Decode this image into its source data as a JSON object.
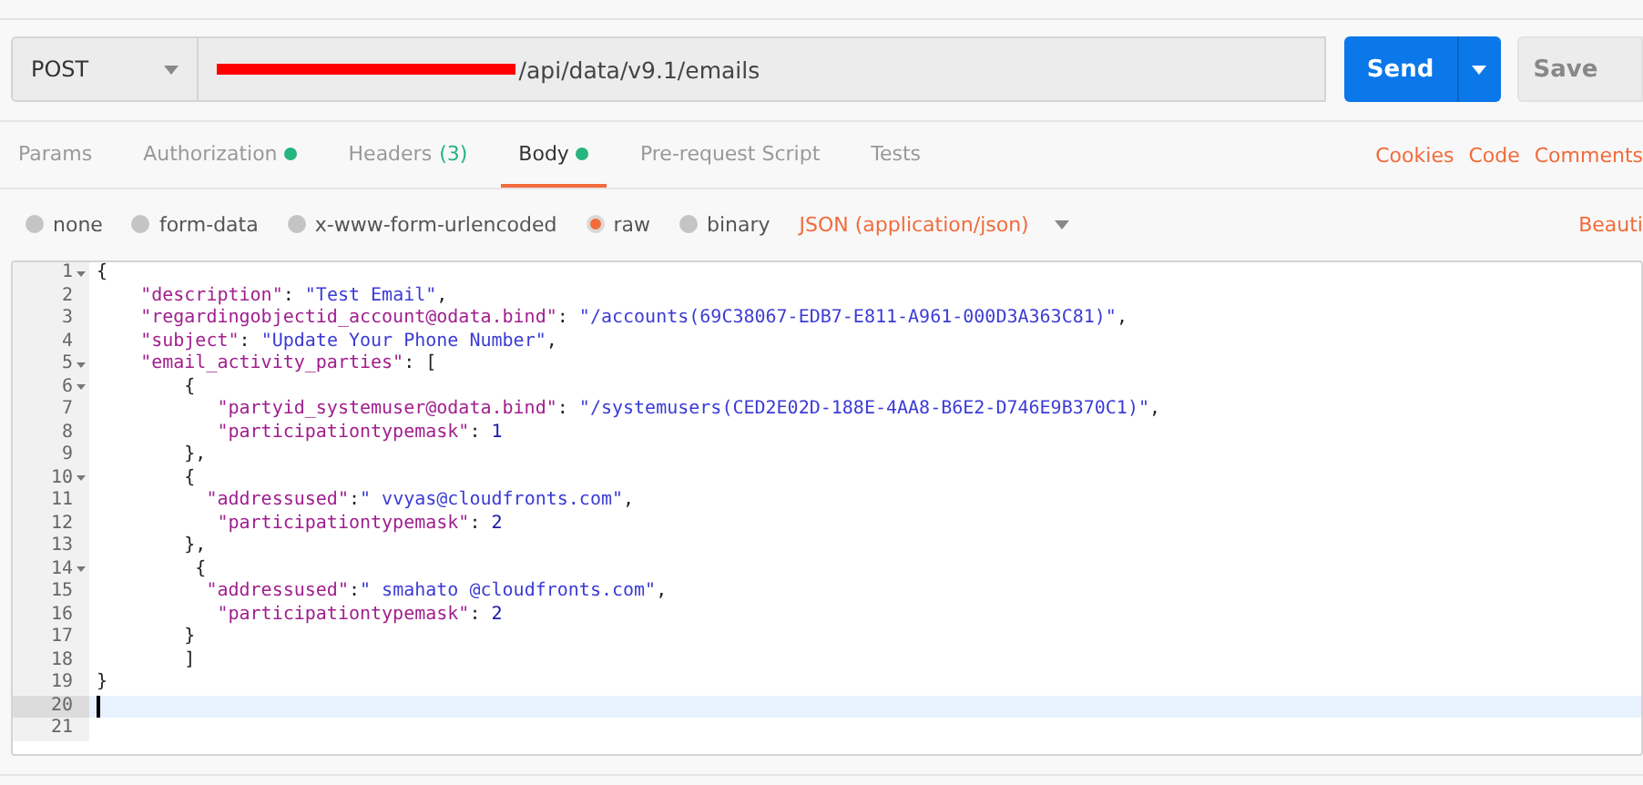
{
  "request": {
    "method": "POST",
    "url": "/api/data/v9.1/emails",
    "send_label": "Send",
    "save_label": "Save"
  },
  "tabs": [
    {
      "label": "Params",
      "selected": false,
      "indicator": false
    },
    {
      "label": "Authorization",
      "selected": false,
      "indicator": true
    },
    {
      "label": "Headers",
      "count": "(3)",
      "selected": false,
      "indicator": false
    },
    {
      "label": "Body",
      "selected": true,
      "indicator": true
    },
    {
      "label": "Pre-request Script",
      "selected": false,
      "indicator": false
    },
    {
      "label": "Tests",
      "selected": false,
      "indicator": false
    }
  ],
  "links": [
    "Cookies",
    "Code",
    "Comments"
  ],
  "body_types": [
    {
      "label": "none",
      "selected": false
    },
    {
      "label": "form-data",
      "selected": false
    },
    {
      "label": "x-www-form-urlencoded",
      "selected": false
    },
    {
      "label": "raw",
      "selected": true
    },
    {
      "label": "binary",
      "selected": false
    }
  ],
  "format": "JSON (application/json)",
  "beautify": "Beauti",
  "editor": {
    "lines": [
      {
        "number": "1",
        "foldable": true,
        "selected": false,
        "tokens": [
          {
            "kind": "punct",
            "text": "{"
          }
        ]
      },
      {
        "number": "2",
        "foldable": false,
        "selected": false,
        "tokens": [
          {
            "kind": "key",
            "text": "    \"description\""
          },
          {
            "kind": "punct",
            "text": ": "
          },
          {
            "kind": "string",
            "text": "\"Test Email\""
          },
          {
            "kind": "punct",
            "text": ","
          }
        ]
      },
      {
        "number": "3",
        "foldable": false,
        "selected": false,
        "tokens": [
          {
            "kind": "key",
            "text": "    \"regardingobjectid_account@odata.bind\""
          },
          {
            "kind": "punct",
            "text": ": "
          },
          {
            "kind": "string",
            "text": "\"/accounts(69C38067-EDB7-E811-A961-000D3A363C81)\""
          },
          {
            "kind": "punct",
            "text": ","
          }
        ]
      },
      {
        "number": "4",
        "foldable": false,
        "selected": false,
        "tokens": [
          {
            "kind": "key",
            "text": "    \"subject\""
          },
          {
            "kind": "punct",
            "text": ": "
          },
          {
            "kind": "string",
            "text": "\"Update Your Phone Number\""
          },
          {
            "kind": "punct",
            "text": ","
          }
        ]
      },
      {
        "number": "5",
        "foldable": true,
        "selected": false,
        "tokens": [
          {
            "kind": "key",
            "text": "    \"email_activity_parties\""
          },
          {
            "kind": "punct",
            "text": ": ["
          }
        ]
      },
      {
        "number": "6",
        "foldable": true,
        "selected": false,
        "tokens": [
          {
            "kind": "punct",
            "text": "        {"
          }
        ]
      },
      {
        "number": "7",
        "foldable": false,
        "selected": false,
        "tokens": [
          {
            "kind": "key",
            "text": "           \"partyid_systemuser@odata.bind\""
          },
          {
            "kind": "punct",
            "text": ": "
          },
          {
            "kind": "string",
            "text": "\"/systemusers(CED2E02D-188E-4AA8-B6E2-D746E9B370C1)\""
          },
          {
            "kind": "punct",
            "text": ","
          }
        ]
      },
      {
        "number": "8",
        "foldable": false,
        "selected": false,
        "tokens": [
          {
            "kind": "key",
            "text": "           \"participationtypemask\""
          },
          {
            "kind": "punct",
            "text": ": "
          },
          {
            "kind": "number",
            "text": "1"
          }
        ]
      },
      {
        "number": "9",
        "foldable": false,
        "selected": false,
        "tokens": [
          {
            "kind": "punct",
            "text": "        },"
          }
        ]
      },
      {
        "number": "10",
        "foldable": true,
        "selected": false,
        "tokens": [
          {
            "kind": "punct",
            "text": "        {"
          }
        ]
      },
      {
        "number": "11",
        "foldable": false,
        "selected": false,
        "tokens": [
          {
            "kind": "key",
            "text": "          \"addressused\""
          },
          {
            "kind": "punct",
            "text": ":"
          },
          {
            "kind": "string",
            "text": "\" vvyas@cloudfronts.com\""
          },
          {
            "kind": "punct",
            "text": ","
          }
        ]
      },
      {
        "number": "12",
        "foldable": false,
        "selected": false,
        "tokens": [
          {
            "kind": "key",
            "text": "           \"participationtypemask\""
          },
          {
            "kind": "punct",
            "text": ": "
          },
          {
            "kind": "number",
            "text": "2"
          }
        ]
      },
      {
        "number": "13",
        "foldable": false,
        "selected": false,
        "tokens": [
          {
            "kind": "punct",
            "text": "        },"
          }
        ]
      },
      {
        "number": "14",
        "foldable": true,
        "selected": false,
        "tokens": [
          {
            "kind": "punct",
            "text": "         {"
          }
        ]
      },
      {
        "number": "15",
        "foldable": false,
        "selected": false,
        "tokens": [
          {
            "kind": "key",
            "text": "          \"addressused\""
          },
          {
            "kind": "punct",
            "text": ":"
          },
          {
            "kind": "string",
            "text": "\" smahato @cloudfronts.com\""
          },
          {
            "kind": "punct",
            "text": ","
          }
        ]
      },
      {
        "number": "16",
        "foldable": false,
        "selected": false,
        "tokens": [
          {
            "kind": "key",
            "text": "           \"participationtypemask\""
          },
          {
            "kind": "punct",
            "text": ": "
          },
          {
            "kind": "number",
            "text": "2"
          }
        ]
      },
      {
        "number": "17",
        "foldable": false,
        "selected": false,
        "tokens": [
          {
            "kind": "punct",
            "text": "        }"
          }
        ]
      },
      {
        "number": "18",
        "foldable": false,
        "selected": false,
        "tokens": [
          {
            "kind": "punct",
            "text": "        ]"
          }
        ]
      },
      {
        "number": "19",
        "foldable": false,
        "selected": false,
        "tokens": [
          {
            "kind": "punct",
            "text": "}"
          }
        ]
      },
      {
        "number": "20",
        "foldable": false,
        "selected": true
      },
      {
        "number": "21",
        "foldable": false,
        "selected": false
      }
    ]
  }
}
